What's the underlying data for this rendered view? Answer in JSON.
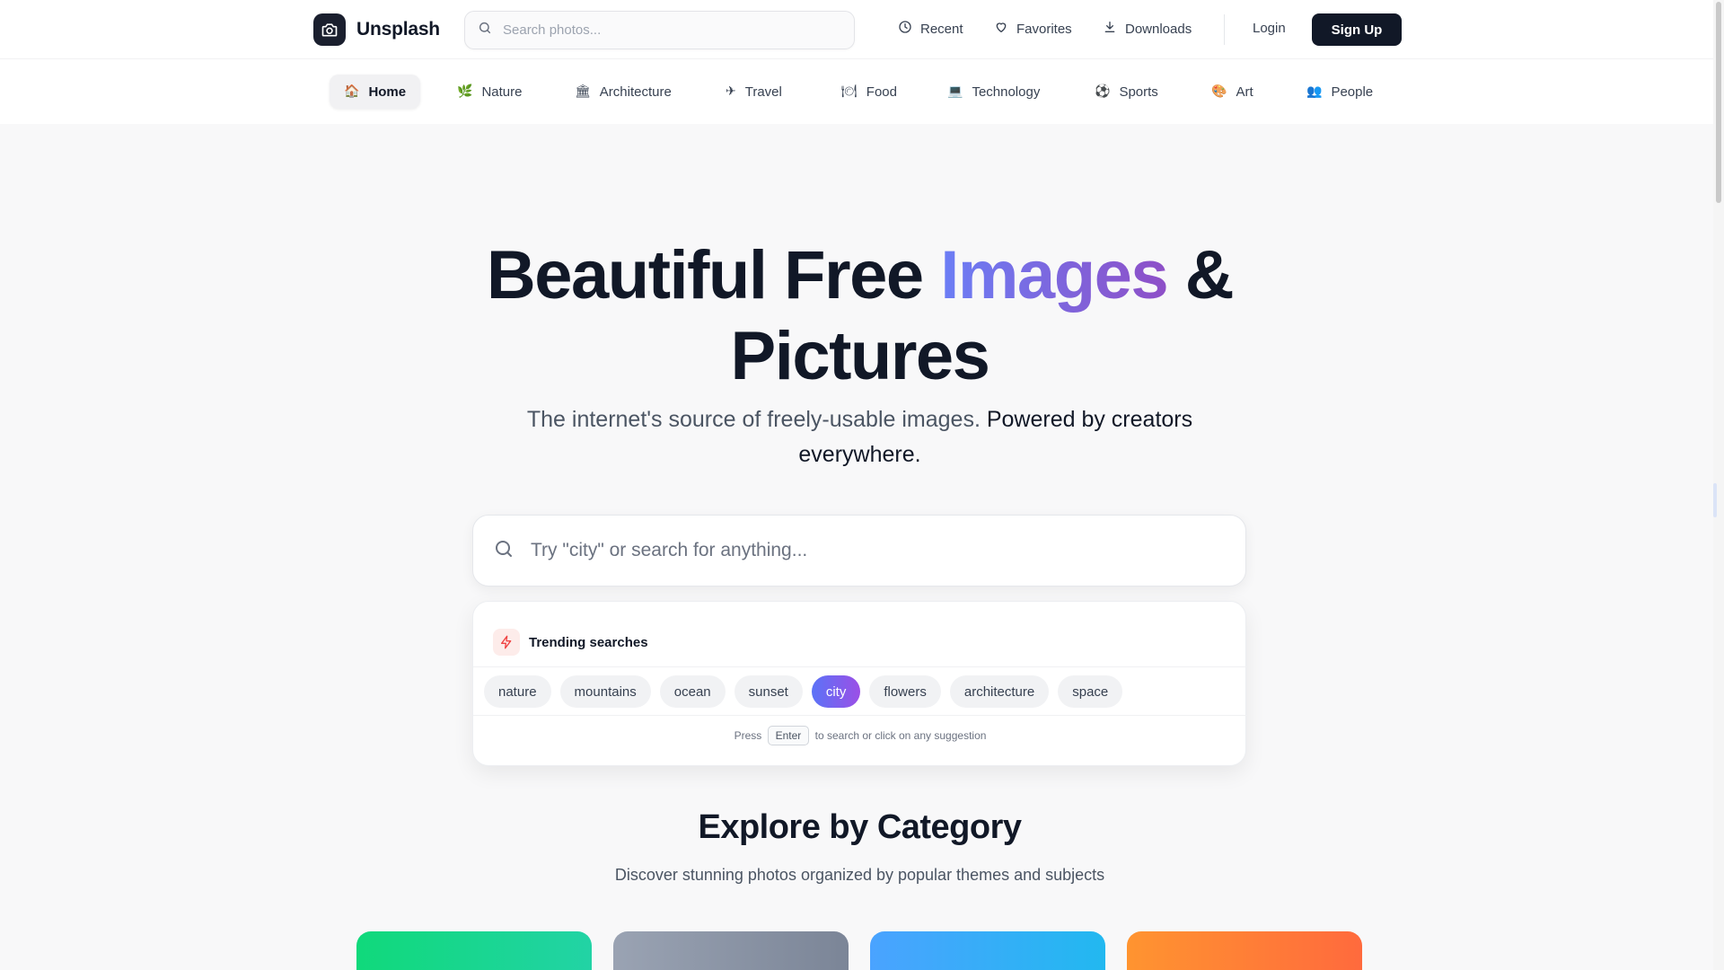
{
  "brand": {
    "name": "Unsplash"
  },
  "header": {
    "search_placeholder": "Search photos...",
    "nav": [
      {
        "label": "Recent",
        "icon": "clock-icon"
      },
      {
        "label": "Favorites",
        "icon": "heart-icon"
      },
      {
        "label": "Downloads",
        "icon": "download-icon"
      }
    ],
    "login_label": "Login",
    "signup_label": "Sign Up"
  },
  "categories": [
    {
      "label": "Home",
      "emoji": "🏠",
      "active": true
    },
    {
      "label": "Nature",
      "emoji": "🌿"
    },
    {
      "label": "Architecture",
      "emoji": "🏛"
    },
    {
      "label": "Travel",
      "emoji": "✈"
    },
    {
      "label": "Food",
      "emoji": "🍽"
    },
    {
      "label": "Technology",
      "emoji": "💻"
    },
    {
      "label": "Sports",
      "emoji": "⚽"
    },
    {
      "label": "Art",
      "emoji": "🎨"
    },
    {
      "label": "People",
      "emoji": "👥"
    }
  ],
  "hero": {
    "title_part1": "Beautiful Free ",
    "title_highlight": "Images",
    "title_part2": " &",
    "title_line2": "Pictures",
    "subtitle_plain": "The internet's source of freely-usable images. ",
    "subtitle_strong": "Powered by creators everywhere."
  },
  "main_search": {
    "placeholder": "Try \"city\" or search for anything..."
  },
  "trending": {
    "title": "Trending searches",
    "chips": [
      "nature",
      "mountains",
      "ocean",
      "sunset",
      "city",
      "flowers",
      "architecture",
      "space"
    ],
    "active_chip": "city",
    "hint_before": "Press",
    "hint_key": "Enter",
    "hint_after": "to search or click on any suggestion"
  },
  "explore": {
    "title": "Explore by Category",
    "subtitle": "Discover stunning photos organized by popular themes and subjects"
  },
  "colors": {
    "accent_gradient_start": "#5b73f7",
    "accent_gradient_end": "#9b4fe6",
    "dark": "#111827",
    "card_gradients": [
      [
        "#10d97b",
        "#22d3a5"
      ],
      [
        "#9aa3b3",
        "#7b8597"
      ],
      [
        "#4aa3ff",
        "#22b8f0"
      ],
      [
        "#ff9430",
        "#ff6a3d"
      ]
    ]
  }
}
